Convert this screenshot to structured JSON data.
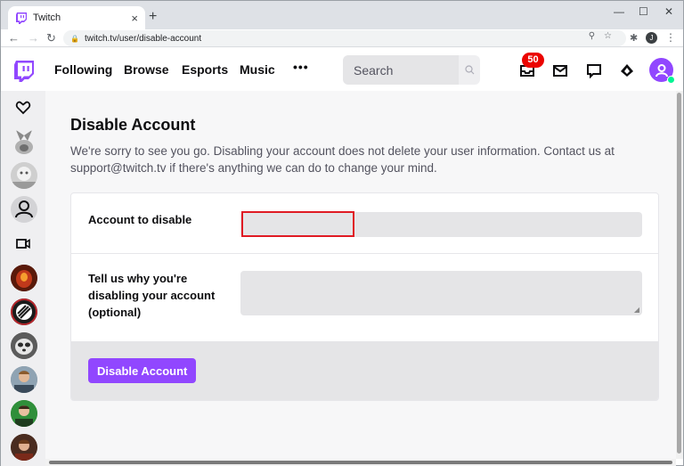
{
  "browser": {
    "tab_title": "Twitch",
    "tab_close": "×",
    "new_tab": "+",
    "url": "twitch.tv/user/disable-account",
    "profile_initial": "J"
  },
  "nav": {
    "links": [
      "Following",
      "Browse",
      "Esports",
      "Music"
    ],
    "more": "•••",
    "search_placeholder": "Search",
    "notification_count": "50"
  },
  "page": {
    "title": "Disable Account",
    "description": "We're sorry to see you go. Disabling your account does not delete your user information. Contact us at support@twitch.tv if there's anything we can do to change your mind.",
    "account_label": "Account to disable",
    "reason_label": "Tell us why you're disabling your account (optional)",
    "button_label": "Disable Account"
  },
  "colors": {
    "brand": "#9147ff",
    "badge": "#eb0400",
    "highlight": "#e01b24"
  },
  "icons": {
    "favicon": "twitch-favicon",
    "logo": "twitch-logo",
    "search": "search-icon",
    "inbox": "inbox-icon",
    "mail": "mail-icon",
    "whisper": "whisper-icon",
    "crown": "prime-crown-icon",
    "heart": "heart-icon",
    "camera": "camera-icon"
  }
}
